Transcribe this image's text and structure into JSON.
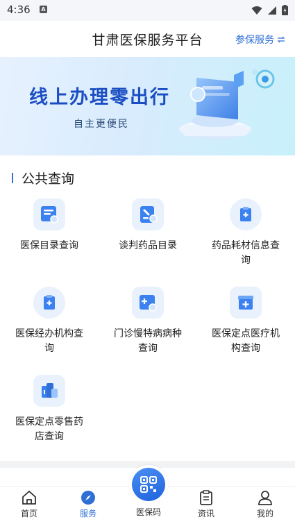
{
  "status_bar": {
    "time": "4:36",
    "notif_glyph": "A"
  },
  "header": {
    "title": "甘肃医保服务平台",
    "action_label": "参保服务",
    "action_icon": "switch-arrows-icon"
  },
  "banner": {
    "headline": "线上办理零出行",
    "subline": "自主更便民"
  },
  "section": {
    "title": "公共查询"
  },
  "services": [
    {
      "label": "医保目录查询",
      "icon": "catalog-search-icon"
    },
    {
      "label": "谈判药品目录",
      "icon": "drug-list-icon"
    },
    {
      "label": "药品耗材信息查询",
      "icon": "supplies-clipboard-icon"
    },
    {
      "label": "医保经办机构查询",
      "icon": "agency-clipboard-icon"
    },
    {
      "label": "门诊慢特病病种查询",
      "icon": "chronic-disease-search-icon"
    },
    {
      "label": "医保定点医疗机构查询",
      "icon": "medical-institution-icon"
    },
    {
      "label": "医保定点零售药店查询",
      "icon": "pharmacy-building-icon"
    }
  ],
  "tabbar": {
    "tabs": [
      {
        "label": "首页",
        "icon": "home-icon",
        "active": false
      },
      {
        "label": "服务",
        "icon": "compass-icon",
        "active": true
      },
      {
        "label": "医保码",
        "icon": "qr-code-icon",
        "active": false
      },
      {
        "label": "资讯",
        "icon": "news-clipboard-icon",
        "active": false
      },
      {
        "label": "我的",
        "icon": "user-icon",
        "active": false
      }
    ]
  },
  "colors": {
    "accent": "#2f6fd6",
    "banner_text": "#1a4ec2"
  }
}
